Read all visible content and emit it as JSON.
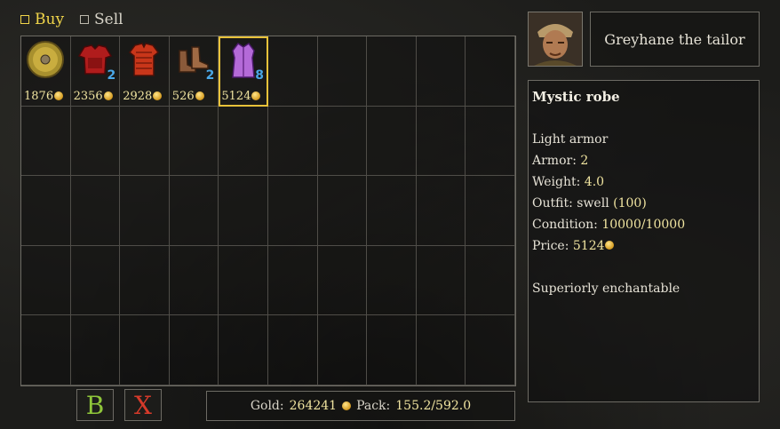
{
  "tabs": {
    "buy": "Buy",
    "sell": "Sell"
  },
  "items": [
    {
      "name": "round-shield",
      "price": "1876",
      "qty": ""
    },
    {
      "name": "red-leather-armor",
      "price": "2356",
      "qty": "2"
    },
    {
      "name": "red-scale-armor",
      "price": "2928",
      "qty": ""
    },
    {
      "name": "leather-boots",
      "price": "526",
      "qty": "2"
    },
    {
      "name": "mystic-robe",
      "price": "5124",
      "qty": "8",
      "selected": true
    }
  ],
  "buttons": {
    "back": "B",
    "close": "X"
  },
  "status": {
    "gold_label": "Gold:",
    "gold_value": "264241",
    "pack_label": "Pack:",
    "pack_value": "155.2/592.0"
  },
  "merchant": {
    "name": "Greyhane the tailor"
  },
  "details": {
    "title": "Mystic robe",
    "type": "Light armor",
    "armor_label": "Armor:",
    "armor_value": "2",
    "weight_label": "Weight:",
    "weight_value": "4.0",
    "outfit_label": "Outfit:",
    "outfit_text": "swell",
    "outfit_value": "(100)",
    "condition_label": "Condition:",
    "condition_value": "10000/10000",
    "price_label": "Price:",
    "price_value": "5124",
    "note": "Superiorly enchantable"
  },
  "colors": {
    "accent": "#f1d64a",
    "quantity": "#4aa8e8",
    "value": "#f0e4a0",
    "selection": "#e8c23a"
  }
}
